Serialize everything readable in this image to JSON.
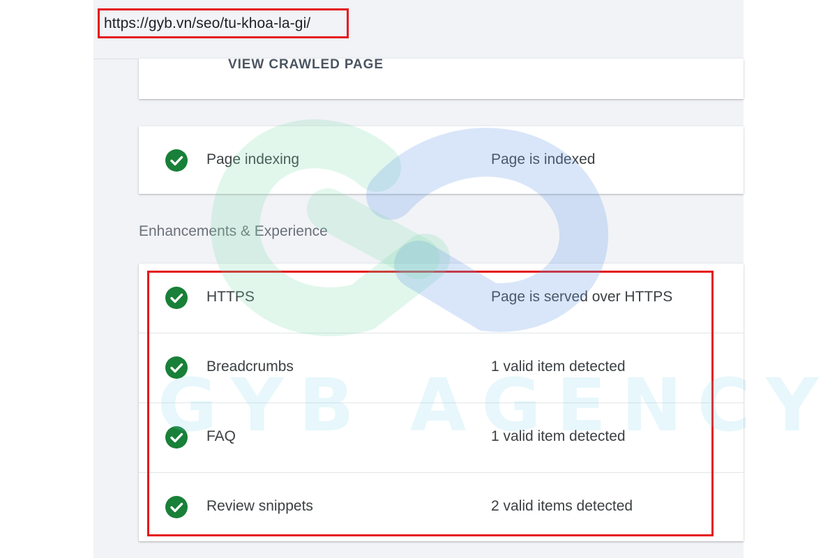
{
  "url_bar": {
    "url": "https://gyb.vn/seo/tu-khoa-la-gi/"
  },
  "crawled": {
    "link_label": "VIEW CRAWLED PAGE"
  },
  "indexing": {
    "label": "Page indexing",
    "status": "Page is indexed",
    "icon": "check-circle-icon"
  },
  "enhancements": {
    "section_title": "Enhancements & Experience",
    "rows": [
      {
        "label": "HTTPS",
        "status": "Page is served over HTTPS",
        "icon": "check-circle-icon"
      },
      {
        "label": "Breadcrumbs",
        "status": "1 valid item detected",
        "icon": "check-circle-icon"
      },
      {
        "label": "FAQ",
        "status": "1 valid item detected",
        "icon": "check-circle-icon"
      },
      {
        "label": "Review snippets",
        "status": "2 valid items detected",
        "icon": "check-circle-icon"
      }
    ]
  },
  "watermark": {
    "text": "GYB AGENCY"
  },
  "colors": {
    "check_green": "#188038",
    "highlight_red": "#e4161b",
    "panel_bg": "#f1f3f7",
    "card_bg": "#ffffff",
    "text_primary": "#3c4043",
    "text_secondary": "#6b7079"
  }
}
